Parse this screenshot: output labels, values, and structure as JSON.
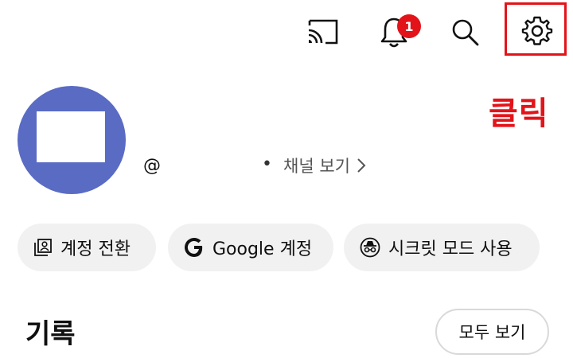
{
  "header": {
    "notification_count": "1",
    "icons": [
      "cast-icon",
      "bell-icon",
      "search-icon",
      "gear-icon"
    ]
  },
  "annotation": {
    "label": "클릭",
    "color": "#e3131a"
  },
  "profile": {
    "handle": "@",
    "channel_link": "채널 보기",
    "avatar_color": "#5a6bc4"
  },
  "chips": [
    {
      "label": "계정 전환",
      "icon": "switch-account-icon"
    },
    {
      "label": "Google 계정",
      "icon": "google-logo-icon"
    },
    {
      "label": "시크릿 모드 사용",
      "icon": "incognito-icon"
    }
  ],
  "history": {
    "title": "기록",
    "view_all": "모두 보기"
  }
}
